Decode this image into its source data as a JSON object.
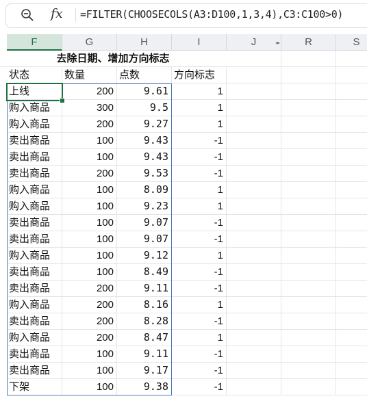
{
  "formula_bar": {
    "zoom_icon": "zoom-magnifier-icon",
    "fx_label": "fx",
    "formula": "=FILTER(CHOOSECOLS(A3:D100,1,3,4),C3:C100>0)"
  },
  "columns": [
    "F",
    "G",
    "H",
    "I",
    "J",
    "R",
    "S"
  ],
  "active_column": "F",
  "sheet": {
    "title": "去除日期、增加方向标志",
    "headers": [
      "状态",
      "数量",
      "点数",
      "方向标志"
    ],
    "rows": [
      [
        "上线",
        "200",
        "9.61",
        "1"
      ],
      [
        "购入商品",
        "300",
        "9.5",
        "1"
      ],
      [
        "购入商品",
        "200",
        "9.27",
        "1"
      ],
      [
        "卖出商品",
        "100",
        "9.43",
        "-1"
      ],
      [
        "卖出商品",
        "100",
        "9.43",
        "-1"
      ],
      [
        "卖出商品",
        "200",
        "9.53",
        "-1"
      ],
      [
        "购入商品",
        "100",
        "8.09",
        "1"
      ],
      [
        "购入商品",
        "100",
        "9.23",
        "1"
      ],
      [
        "卖出商品",
        "100",
        "9.07",
        "-1"
      ],
      [
        "卖出商品",
        "100",
        "9.07",
        "-1"
      ],
      [
        "购入商品",
        "100",
        "9.12",
        "1"
      ],
      [
        "卖出商品",
        "100",
        "8.49",
        "-1"
      ],
      [
        "卖出商品",
        "200",
        "9.11",
        "-1"
      ],
      [
        "购入商品",
        "200",
        "8.16",
        "1"
      ],
      [
        "卖出商品",
        "200",
        "8.28",
        "-1"
      ],
      [
        "购入商品",
        "200",
        "8.47",
        "1"
      ],
      [
        "卖出商品",
        "100",
        "9.11",
        "-1"
      ],
      [
        "卖出商品",
        "100",
        "9.17",
        "-1"
      ],
      [
        "下架",
        "100",
        "9.38",
        "-1"
      ]
    ]
  },
  "colors": {
    "selection": "#1e7145",
    "spill_border": "#4a78b7",
    "header_bg": "#eef0f3"
  }
}
